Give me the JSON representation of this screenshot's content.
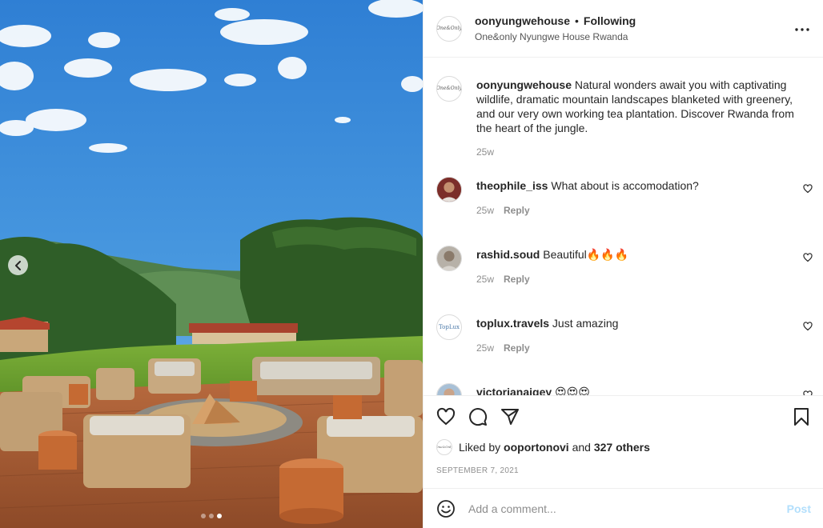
{
  "post": {
    "username": "oonyungwehouse",
    "separator": "•",
    "follow_state": "Following",
    "location": "One&only Nyungwe House Rwanda",
    "brand_logo_text": "One&Only"
  },
  "caption": {
    "username": "oonyungwehouse",
    "text": " Natural wonders await you with captivating wildlife, dramatic mountain landscapes blanketed with greenery, and our very own working tea plantation. Discover Rwanda from the heart of the jungle.",
    "age": "25w"
  },
  "comments": [
    {
      "username": "theophile_iss",
      "text": " What about is accomodation?",
      "age": "25w",
      "reply_label": "Reply"
    },
    {
      "username": "rashid.soud",
      "text": " Beautiful🔥🔥🔥",
      "age": "25w",
      "reply_label": "Reply"
    },
    {
      "username": "toplux.travels",
      "text": " Just amazing",
      "age": "25w",
      "reply_label": "Reply",
      "avatar_text": "TopLux"
    },
    {
      "username": "victorianaigey",
      "text": " 😍😍😍",
      "age": "",
      "reply_label": ""
    }
  ],
  "likes": {
    "prefix": "Liked by ",
    "liker": "ooportonovi",
    "middle": " and ",
    "others": "327 others"
  },
  "date": "SEPTEMBER 7, 2021",
  "add_comment": {
    "placeholder": "Add a comment...",
    "post_label": "Post"
  },
  "carousel": {
    "count": 3,
    "active_index": 2
  },
  "icons": {
    "prev": "chevron-left-icon",
    "more": "more-horizontal-icon",
    "like": "heart-icon",
    "comment": "comment-icon",
    "share": "paper-plane-icon",
    "save": "bookmark-icon",
    "emoji": "smiley-icon"
  },
  "colors": {
    "post_button": "#b2dffc",
    "muted_text": "#8e8e8e",
    "divider": "#efefef"
  }
}
